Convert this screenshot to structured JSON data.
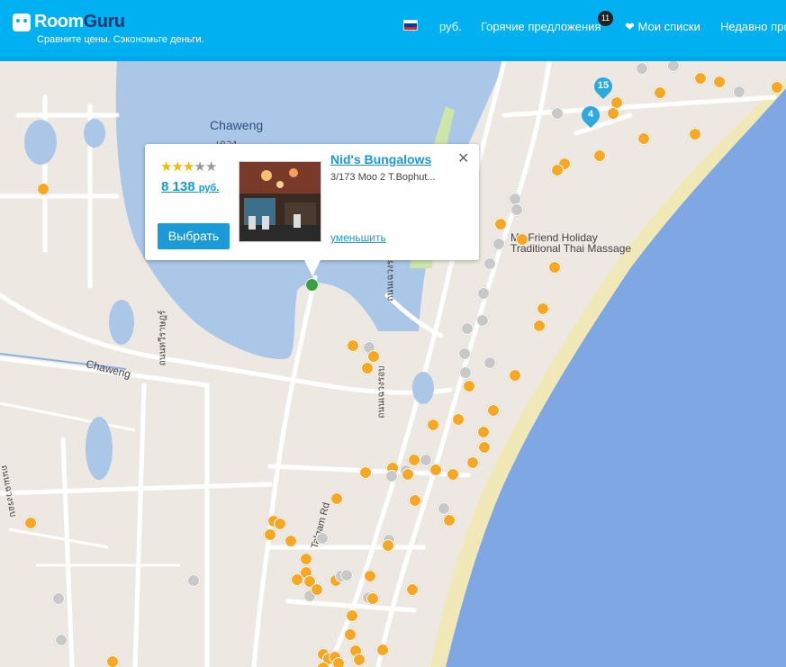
{
  "header": {
    "logo_room": "Room",
    "logo_guru": "Guru",
    "tagline": "Сравните цены. Сэкономьте деньги.",
    "currency": "руб.",
    "hot_deals": "Горячие предложения",
    "hot_deals_badge": "11",
    "my_lists": "Мои списки",
    "recent": "Недавно про",
    "flag_colors": [
      "#ffffff",
      "#0039a6",
      "#d52b1e"
    ]
  },
  "map": {
    "labels": {
      "chaweng_water": "Chaweng",
      "chaweng_water_thai": "เฉวง",
      "chaweng_road": "Chaweng",
      "friend_massage_line1": "My Friend Holiday",
      "friend_massage_line2": "Traditional Thai Massage",
      "soi_thai_1": "ถนนทวีราษฎร์",
      "soi_thai_2": "ถนนเฉวงรอบ",
      "soi_thai_3": "ถนนเฉวงรอบ",
      "soi_thai_4": "ถนนเฉวงรอบ",
      "road_name": "Talgam Rd"
    },
    "clusters": [
      "15",
      "4"
    ]
  },
  "popup": {
    "stars_filled": 3,
    "stars_total": 5,
    "star_glyph": "★",
    "price": "8 138",
    "currency": "руб.",
    "select_button": "Выбрать",
    "hotel_name": "Nid's Bungalows",
    "address": "3/173 Moo 2 T.Bophut...",
    "shrink_link": "уменьшить",
    "close_glyph": "✕"
  },
  "colors": {
    "header": "#00b0f0",
    "accent": "#1a9bd7",
    "orange_pin": "#f7a823",
    "gray_pin": "#c8c8c8",
    "selected_pin": "#3aa043",
    "water": "#aac7e8",
    "sea": "#7ea7e3"
  }
}
